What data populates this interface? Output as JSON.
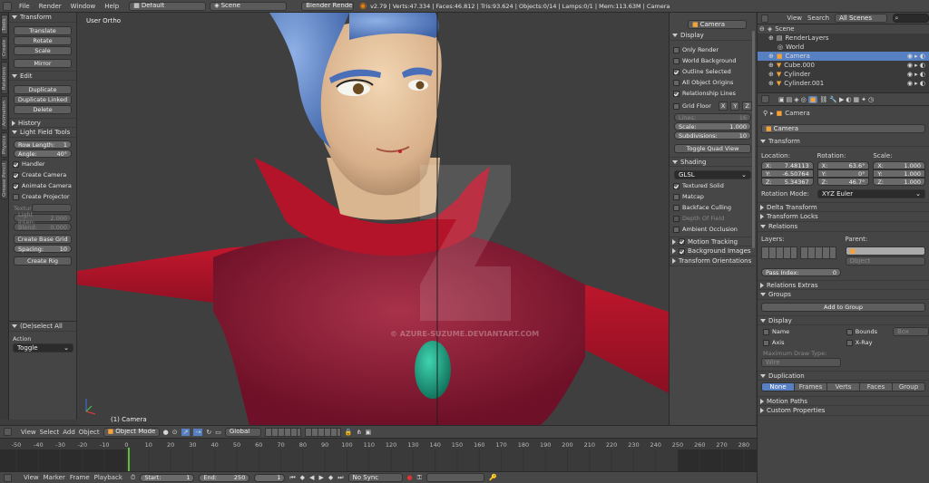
{
  "topbar": {
    "menus": [
      "File",
      "Render",
      "Window",
      "Help"
    ],
    "screen": "Default",
    "scene": "Scene",
    "engine": "Blender Render",
    "stats": "v2.79 | Verts:47.334 | Faces:46.812 | Tris:93.624 | Objects:0/14 | Lamps:0/1 | Mem:113.63M | Camera"
  },
  "tabs": [
    "Tools",
    "Create",
    "Relations",
    "Animation",
    "Physics",
    "Grease Pencil"
  ],
  "tools": {
    "transform": {
      "title": "Transform",
      "buttons": [
        "Translate",
        "Rotate",
        "Scale"
      ],
      "mirror": "Mirror"
    },
    "edit": {
      "title": "Edit",
      "buttons": [
        "Duplicate",
        "Duplicate Linked",
        "Delete"
      ]
    },
    "history": "History",
    "lightfield": {
      "title": "Light Field Tools",
      "row_length_label": "Row Length:",
      "row_length": "1",
      "angle_label": "Angle:",
      "angle": "40°",
      "handler": "Handler",
      "create_camera": "Create Camera",
      "animate_camera": "Animate Camera",
      "create_projector": "Create Projector",
      "texture_label": "Textur",
      "light_intensity_label": "Light Inten:",
      "light_intensity": "2.000",
      "blend_label": "Blend:",
      "blend": "0.000",
      "create_base_grid": "Create Base Grid",
      "spacing_label": "Spacing:",
      "spacing": "10",
      "create_rig": "Create Rig"
    },
    "deselect": {
      "title": "(De)select All",
      "action_label": "Action",
      "action_value": "Toggle"
    }
  },
  "viewport": {
    "view_label": "User Ortho",
    "object_label": "(1) Camera",
    "watermark": "© AZURE-SUZUME.DEVIANTART.COM"
  },
  "npanel": {
    "camera_name": "Camera",
    "display": {
      "title": "Display",
      "only_render": "Only Render",
      "world_background": "World Background",
      "outline_selected": "Outline Selected",
      "all_object_origins": "All Object Origins",
      "relationship_lines": "Relationship Lines",
      "grid_floor": "Grid Floor",
      "axes": [
        "X",
        "Y",
        "Z"
      ],
      "lines_label": "Lines:",
      "lines": "16",
      "scale_label": "Scale:",
      "scale": "1.000",
      "subdivisions_label": "Subdivisions:",
      "subdivisions": "10",
      "toggle_quad": "Toggle Quad View"
    },
    "shading": {
      "title": "Shading",
      "mode": "GLSL",
      "textured_solid": "Textured Solid",
      "matcap": "Matcap",
      "backface_culling": "Backface Culling",
      "depth_of_field": "Depth Of Field",
      "ambient_occlusion": "Ambient Occlusion"
    },
    "motion_tracking": "Motion Tracking",
    "background_images": "Background Images",
    "transform_orientations": "Transform Orientations"
  },
  "outliner": {
    "view_menu": "View",
    "search_menu": "Search",
    "scenes_dropdown": "All Scenes",
    "items": [
      "Scene",
      "RenderLayers",
      "World",
      "Camera",
      "Cube.000",
      "Cylinder",
      "Cylinder.001"
    ]
  },
  "properties": {
    "breadcrumb": "Camera",
    "object_name": "Camera",
    "transform": {
      "title": "Transform",
      "location_label": "Location:",
      "rotation_label": "Rotation:",
      "scale_label": "Scale:",
      "location": [
        {
          "axis": "X:",
          "value": "7.48113"
        },
        {
          "axis": "Y:",
          "value": "-6.50764"
        },
        {
          "axis": "Z:",
          "value": "5.34367"
        }
      ],
      "rotation": [
        {
          "axis": "X:",
          "value": "63.6°"
        },
        {
          "axis": "Y:",
          "value": "0°"
        },
        {
          "axis": "Z:",
          "value": "46.7°"
        }
      ],
      "scale": [
        {
          "axis": "X:",
          "value": "1.000"
        },
        {
          "axis": "Y:",
          "value": "1.000"
        },
        {
          "axis": "Z:",
          "value": "1.000"
        }
      ],
      "rotation_mode_label": "Rotation Mode:",
      "rotation_mode": "XYZ Euler"
    },
    "delta_transform": "Delta Transform",
    "transform_locks": "Transform Locks",
    "relations": {
      "title": "Relations",
      "layers_label": "Layers:",
      "parent_label": "Parent:",
      "parent_type": "Object",
      "pass_index_label": "Pass Index:",
      "pass_index": "0"
    },
    "relations_extras": "Relations Extras",
    "groups": {
      "title": "Groups",
      "add_to_group": "Add to Group"
    },
    "display": {
      "title": "Display",
      "name": "Name",
      "axis": "Axis",
      "bounds": "Bounds",
      "bounds_type": "Box",
      "xray": "X-Ray",
      "max_draw_type_label": "Maximum Draw Type:",
      "max_draw_type": "Wire"
    },
    "duplication": {
      "title": "Duplication",
      "options": [
        "None",
        "Frames",
        "Verts",
        "Faces",
        "Group"
      ]
    },
    "motion_paths": "Motion Paths",
    "custom_properties": "Custom Properties"
  },
  "view3d_header": {
    "menus": [
      "View",
      "Select",
      "Add",
      "Object"
    ],
    "mode": "Object Mode",
    "orientation": "Global"
  },
  "timeline": {
    "ticks": [
      "-50",
      "-40",
      "-30",
      "-20",
      "-10",
      "0",
      "10",
      "20",
      "30",
      "40",
      "50",
      "60",
      "70",
      "80",
      "90",
      "100",
      "110",
      "120",
      "130",
      "140",
      "150",
      "160",
      "170",
      "180",
      "190",
      "200",
      "210",
      "220",
      "230",
      "240",
      "250",
      "260",
      "270",
      "280"
    ],
    "current_frame": 1,
    "menus": [
      "View",
      "Marker",
      "Frame",
      "Playback"
    ],
    "start_label": "Start:",
    "start": "1",
    "end_label": "End:",
    "end": "250",
    "frame": "1",
    "sync": "No Sync"
  },
  "colors": {
    "selection_blue": "#5680c2",
    "suit_red": "#b3142a",
    "skin": "#e8c7a4",
    "hair_blue": "#5f85c6",
    "gem_teal": "#1c9e7f",
    "frame_marker": "#60c040"
  }
}
